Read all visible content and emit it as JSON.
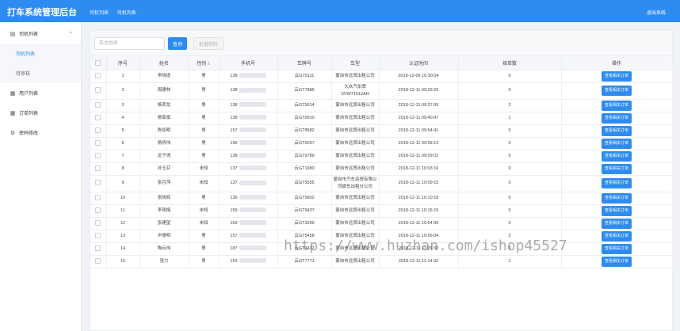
{
  "header": {
    "brand": "打车系统管理后台",
    "breadcrumbs": [
      "司机列表",
      "司机列表"
    ],
    "logout": "退出系统",
    "accent": "#2d8cf0"
  },
  "sidebar": {
    "items": [
      {
        "label": "司机列表",
        "icon": "file-icon",
        "expanded": true,
        "children": [
          {
            "label": "司机列表",
            "active": true
          },
          {
            "label": "待审核",
            "active": false
          }
        ]
      },
      {
        "label": "用户列表",
        "icon": "grid-icon"
      },
      {
        "label": "订单列表",
        "icon": "grid-icon"
      },
      {
        "label": "密码修改",
        "icon": "gear-icon"
      }
    ]
  },
  "toolbar": {
    "search_placeholder": "车主姓名",
    "search_label": "查询",
    "bulk_delete_label": "批量删除"
  },
  "table": {
    "columns": [
      "序号",
      "姓名",
      "性别",
      "手机号",
      "车牌号",
      "车型",
      "认证时间",
      "接单数",
      "操作"
    ],
    "action_label": "查看相关订单",
    "rows": [
      {
        "no": "1",
        "name": "李晓提",
        "gender": "男",
        "phone": "138",
        "plate": "云GT5111",
        "model": "蒙自市远贸出租公司",
        "time": "2018-12-06 10:30:04",
        "orders": "0"
      },
      {
        "no": "2",
        "name": "周建林",
        "gender": "男",
        "phone": "138",
        "plate": "云GT7886",
        "model": "大众汽车牌SVW71612AH",
        "time": "2018-12-11 09:29:29",
        "orders": "0"
      },
      {
        "no": "3",
        "name": "杨荣龙",
        "gender": "男",
        "phone": "138",
        "plate": "云GT5614",
        "model": "蒙自市远贸出租公司",
        "time": "2018-12-11 09:37:09",
        "orders": "2"
      },
      {
        "no": "4",
        "name": "杨家斌",
        "gender": "男",
        "phone": "138",
        "plate": "云GT6910",
        "model": "蒙自市远贸出租公司",
        "time": "2018-12-11 09:40:47",
        "orders": "1"
      },
      {
        "no": "5",
        "name": "陈如明",
        "gender": "男",
        "phone": "157",
        "plate": "云GT8682",
        "model": "蒙自市远贸出租公司",
        "time": "2018-12-11 09:54:41",
        "orders": "0"
      },
      {
        "no": "6",
        "name": "杨桥伟",
        "gender": "男",
        "phone": "199",
        "plate": "云GT6097",
        "model": "蒙自市远贸出租公司",
        "time": "2018-12-11 09:58:13",
        "orders": "0"
      },
      {
        "no": "7",
        "name": "龙子清",
        "gender": "男",
        "phone": "138",
        "plate": "云GT9789",
        "model": "蒙自市远贸出租公司",
        "time": "2018-12-11 09:59:02",
        "orders": "0"
      },
      {
        "no": "8",
        "name": "孙玉芬",
        "gender": "未知",
        "phone": "137",
        "plate": "云GT1980",
        "model": "蒙自市远贸出租公司",
        "time": "2018-12-11 10:03:16",
        "orders": "0"
      },
      {
        "no": "9",
        "name": "张月萍",
        "gender": "未知",
        "phone": "137",
        "plate": "云GT5555",
        "model": "蒙自市汽车运贸有限公司蜻车出租分公司",
        "time": "2018-12-11 10:09:15",
        "orders": "0"
      },
      {
        "no": "10",
        "name": "张晓辉",
        "gender": "男",
        "phone": "136",
        "plate": "云GT5802",
        "model": "蒙自市远贸出租公司",
        "time": "2018-12-11 10:10:18",
        "orders": "0"
      },
      {
        "no": "11",
        "name": "李艳梅",
        "gender": "未知",
        "phone": "159",
        "plate": "云GT9437",
        "model": "蒙自市远贸出租公司",
        "time": "2018-12-11 10:16:15",
        "orders": "0"
      },
      {
        "no": "12",
        "name": "张建望",
        "gender": "未知",
        "phone": "159",
        "plate": "云GT3299",
        "model": "蒙自市远贸出租公司",
        "time": "2018-12-11 10:54:39",
        "orders": "0"
      },
      {
        "no": "13",
        "name": "尹德明",
        "gender": "男",
        "phone": "157",
        "plate": "云GT5458",
        "model": "蒙自市远贸出租公司",
        "time": "2018-12-11 10:56:04",
        "orders": "2"
      },
      {
        "no": "14",
        "name": "陶云伟",
        "gender": "男",
        "phone": "187",
        "plate": "云GT9437",
        "model": "蒙自市远贸出租公司",
        "time": "2018-12-11 11:05:32",
        "orders": "0"
      },
      {
        "no": "15",
        "name": "张力",
        "gender": "男",
        "phone": "153",
        "plate": "云GT7771",
        "model": "蒙自市远贸出租公司",
        "time": "2018-12-11 11:14:32",
        "orders": "1"
      }
    ]
  },
  "watermark": "https://www.huzhan.com/ishop45527"
}
